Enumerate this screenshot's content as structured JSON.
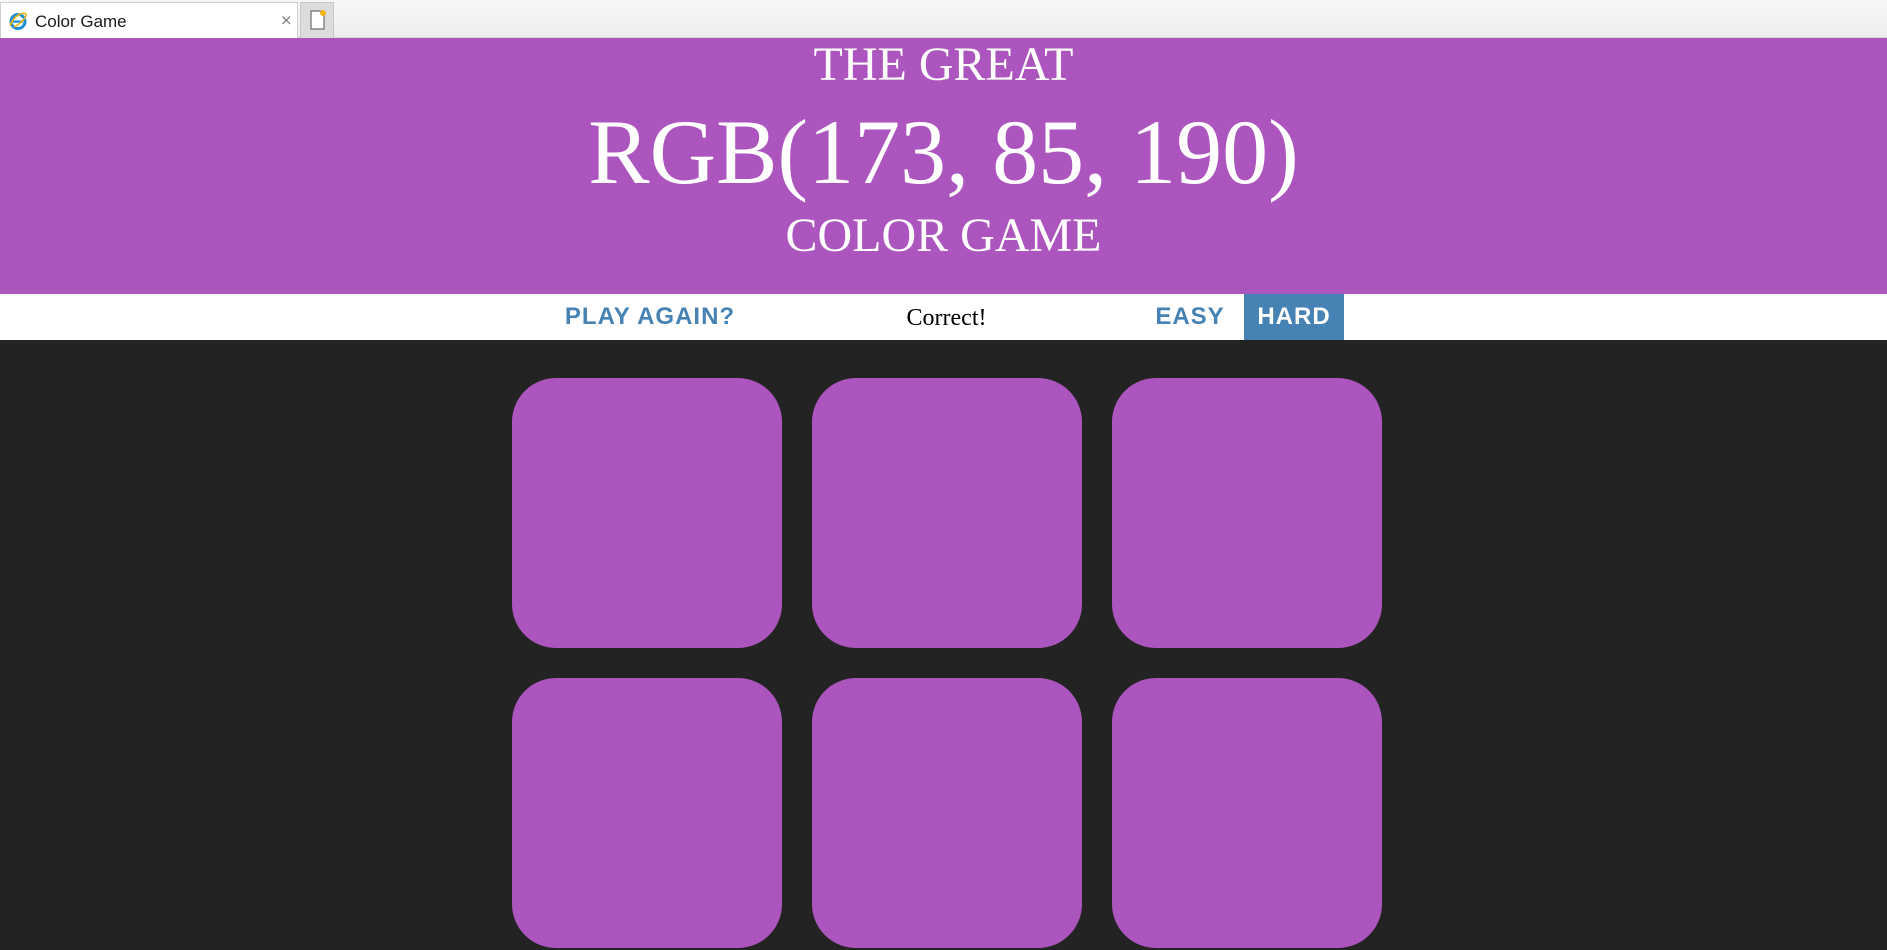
{
  "browser": {
    "tab_title": "Color Game",
    "tab_close": "×",
    "favicon": "internet-explorer-icon",
    "new_tab_icon": "new-tab-icon"
  },
  "header": {
    "line1": "THE GREAT",
    "rgb_display": "RGB(173, 85, 190)",
    "line3": "COLOR GAME"
  },
  "controls": {
    "reset_label": "PLAY AGAIN?",
    "message": "Correct!",
    "easy_label": "EASY",
    "hard_label": "HARD",
    "selected_mode": "HARD"
  },
  "colors": {
    "target": "#ad55be",
    "background": "#232323",
    "accent": "#4682b4"
  },
  "squares": [
    {
      "color": "#ad55be"
    },
    {
      "color": "#ad55be"
    },
    {
      "color": "#ad55be"
    },
    {
      "color": "#ad55be"
    },
    {
      "color": "#ad55be"
    },
    {
      "color": "#ad55be"
    }
  ]
}
